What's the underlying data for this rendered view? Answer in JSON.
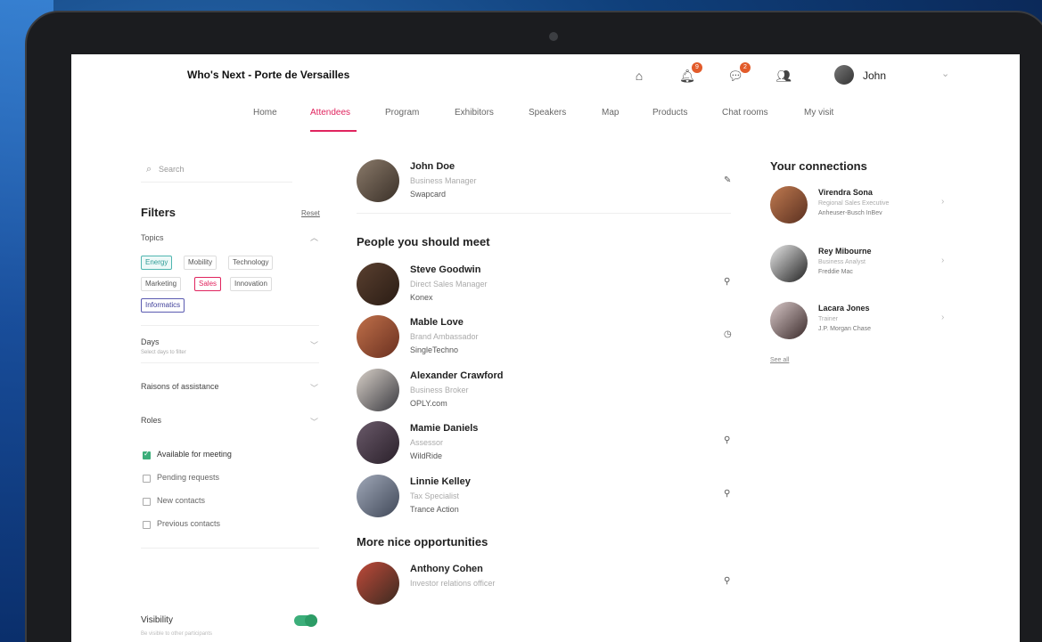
{
  "header": {
    "event_title": "Who's Next - Porte de Versailles",
    "notifications_count": "9",
    "messages_count": "2",
    "user_name": "John"
  },
  "nav": {
    "items": [
      "Home",
      "Attendees",
      "Program",
      "Exhibitors",
      "Speakers",
      "Map",
      "Products",
      "Chat rooms",
      "My visit"
    ],
    "active": "Attendees"
  },
  "sidebar": {
    "search_placeholder": "Search",
    "filters_title": "Filters",
    "reset_label": "Reset",
    "topics_label": "Topics",
    "tags": [
      "Energy",
      "Mobility",
      "Technology",
      "Marketing",
      "Sales",
      "Innovation",
      "Informatics"
    ],
    "days_label": "Days",
    "days_sub": "Select days to filter",
    "reasons_label": "Raisons of assistance",
    "roles_label": "Roles",
    "checkboxes": [
      {
        "label": "Available for meeting",
        "checked": true
      },
      {
        "label": "Pending requests",
        "checked": false
      },
      {
        "label": "New contacts",
        "checked": false
      },
      {
        "label": "Previous contacts",
        "checked": false
      }
    ],
    "visibility_label": "Visibility",
    "visibility_sub": "Be visible to other participants"
  },
  "main": {
    "me": {
      "name": "John Doe",
      "role": "Business Manager",
      "company": "Swapcard"
    },
    "section1_title": "People you should meet",
    "people": [
      {
        "name": "Steve Goodwin",
        "role": "Direct Sales Manager",
        "company": "Konex"
      },
      {
        "name": "Mable Love",
        "role": "Brand Ambassador",
        "company": "SingleTechno"
      },
      {
        "name": "Alexander Crawford",
        "role": "Business Broker",
        "company": "OPLY.com"
      },
      {
        "name": "Mamie Daniels",
        "role": "Assessor",
        "company": "WildRide"
      },
      {
        "name": "Linnie Kelley",
        "role": "Tax Specialist",
        "company": "Trance Action"
      }
    ],
    "section2_title": "More nice opportunities",
    "more": [
      {
        "name": "Anthony Cohen",
        "role": "Investor relations officer",
        "company": ""
      }
    ]
  },
  "right": {
    "title": "Your connections",
    "connections": [
      {
        "name": "Virendra Sona",
        "role": "Regional Sales Executive",
        "company": "Anheuser-Busch InBev"
      },
      {
        "name": "Rey Mibourne",
        "role": "Business Analyst",
        "company": "Freddie Mac"
      },
      {
        "name": "Lacara Jones",
        "role": "Trainer",
        "company": "J.P. Morgan Chase"
      }
    ],
    "see_all": "See all"
  }
}
